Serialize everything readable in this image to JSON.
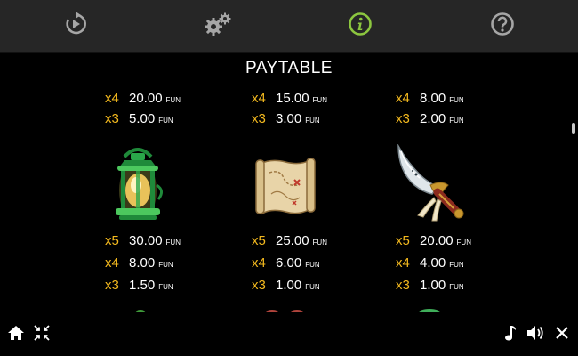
{
  "title": "PAYTABLE",
  "colors": {
    "accent_info": "#8cc63f",
    "multiplier": "#f2b81e",
    "icon_gray": "#a6a6a6"
  },
  "toolbar": {
    "items": [
      {
        "icon": "autoplay-icon"
      },
      {
        "icon": "settings-gears-icon"
      },
      {
        "icon": "info-icon",
        "active": true
      },
      {
        "icon": "help-icon"
      }
    ]
  },
  "columns": [
    {
      "top_rows": [
        {
          "mult": "x4",
          "value": "20.00",
          "unit": "FUN"
        },
        {
          "mult": "x3",
          "value": "5.00",
          "unit": "FUN"
        }
      ],
      "symbol": "lantern-symbol",
      "rows": [
        {
          "mult": "x5",
          "value": "30.00",
          "unit": "FUN"
        },
        {
          "mult": "x4",
          "value": "8.00",
          "unit": "FUN"
        },
        {
          "mult": "x3",
          "value": "1.50",
          "unit": "FUN"
        }
      ]
    },
    {
      "top_rows": [
        {
          "mult": "x4",
          "value": "15.00",
          "unit": "FUN"
        },
        {
          "mult": "x3",
          "value": "3.00",
          "unit": "FUN"
        }
      ],
      "symbol": "treasure-map-symbol",
      "rows": [
        {
          "mult": "x5",
          "value": "25.00",
          "unit": "FUN"
        },
        {
          "mult": "x4",
          "value": "6.00",
          "unit": "FUN"
        },
        {
          "mult": "x3",
          "value": "1.00",
          "unit": "FUN"
        }
      ]
    },
    {
      "top_rows": [
        {
          "mult": "x4",
          "value": "8.00",
          "unit": "FUN"
        },
        {
          "mult": "x3",
          "value": "2.00",
          "unit": "FUN"
        }
      ],
      "symbol": "cutlass-symbol",
      "rows": [
        {
          "mult": "x5",
          "value": "20.00",
          "unit": "FUN"
        },
        {
          "mult": "x4",
          "value": "4.00",
          "unit": "FUN"
        },
        {
          "mult": "x3",
          "value": "1.00",
          "unit": "FUN"
        }
      ]
    }
  ],
  "bottom_bar": {
    "left": [
      {
        "icon": "home-icon"
      },
      {
        "icon": "exit-fullscreen-icon"
      }
    ],
    "right": [
      {
        "icon": "music-note-icon"
      },
      {
        "icon": "sound-icon"
      },
      {
        "icon": "close-icon"
      }
    ]
  }
}
